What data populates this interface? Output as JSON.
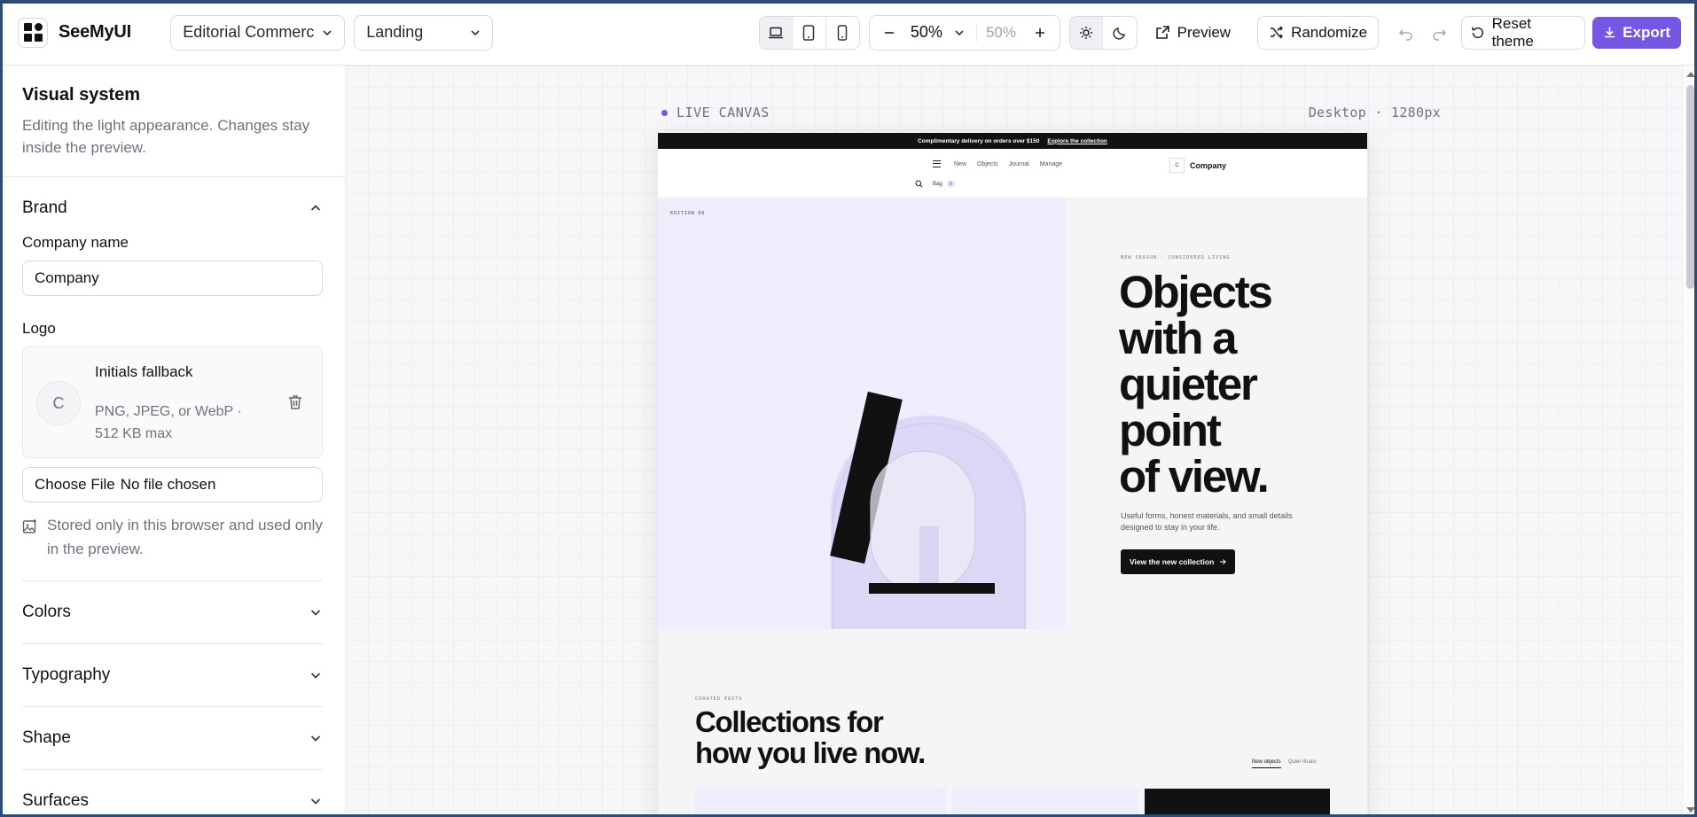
{
  "app": {
    "name": "SeeMyUI",
    "template_select": "Editorial Commerce",
    "page_select": "Landing",
    "zoom_value": "50%",
    "zoom_readout": "50%",
    "preview_label": "Preview",
    "randomize_label": "Randomize",
    "reset_label": "Reset theme",
    "export_label": "Export",
    "accent_color": "#7657e3"
  },
  "sidebar": {
    "title": "Visual system",
    "subtitle": "Editing the light appearance. Changes stay inside the preview.",
    "brand": {
      "heading": "Brand",
      "company_label": "Company name",
      "company_value": "Company",
      "logo_label": "Logo",
      "logo_initial": "C",
      "logo_title": "Initials fallback",
      "logo_hint": "PNG, JPEG, or WebP · 512 KB max",
      "file_button": "Choose File",
      "file_status": "No file chosen",
      "storage_note": "Stored only in this browser and used only in the preview."
    },
    "sections": [
      "Colors",
      "Typography",
      "Shape",
      "Surfaces"
    ]
  },
  "canvas": {
    "label": "LIVE CANVAS",
    "meta": "Desktop · 1280px"
  },
  "preview": {
    "announcement": "Complimentary delivery on orders over $150",
    "announcement_link": "Explore the collection",
    "nav_links": [
      "New",
      "Objects",
      "Journal",
      "Manage"
    ],
    "logo_initial": "C",
    "company": "Company",
    "bag_label": "Bag",
    "bag_count": "0",
    "edition": "EDITION 06",
    "hero_eyebrow": "NEW SEASON · CONSIDERED LIVING",
    "hero_title_lines": [
      "Objects",
      "with a",
      "quieter",
      "point",
      "of view."
    ],
    "hero_body": "Useful forms, honest materials, and small details designed to stay in your life.",
    "hero_cta": "View the new collection",
    "section_eyebrow": "CURATED EDITS",
    "section_title_lines": [
      "Collections for",
      "how you live now."
    ],
    "tabs": [
      "New objects",
      "Quiet rituals"
    ]
  }
}
